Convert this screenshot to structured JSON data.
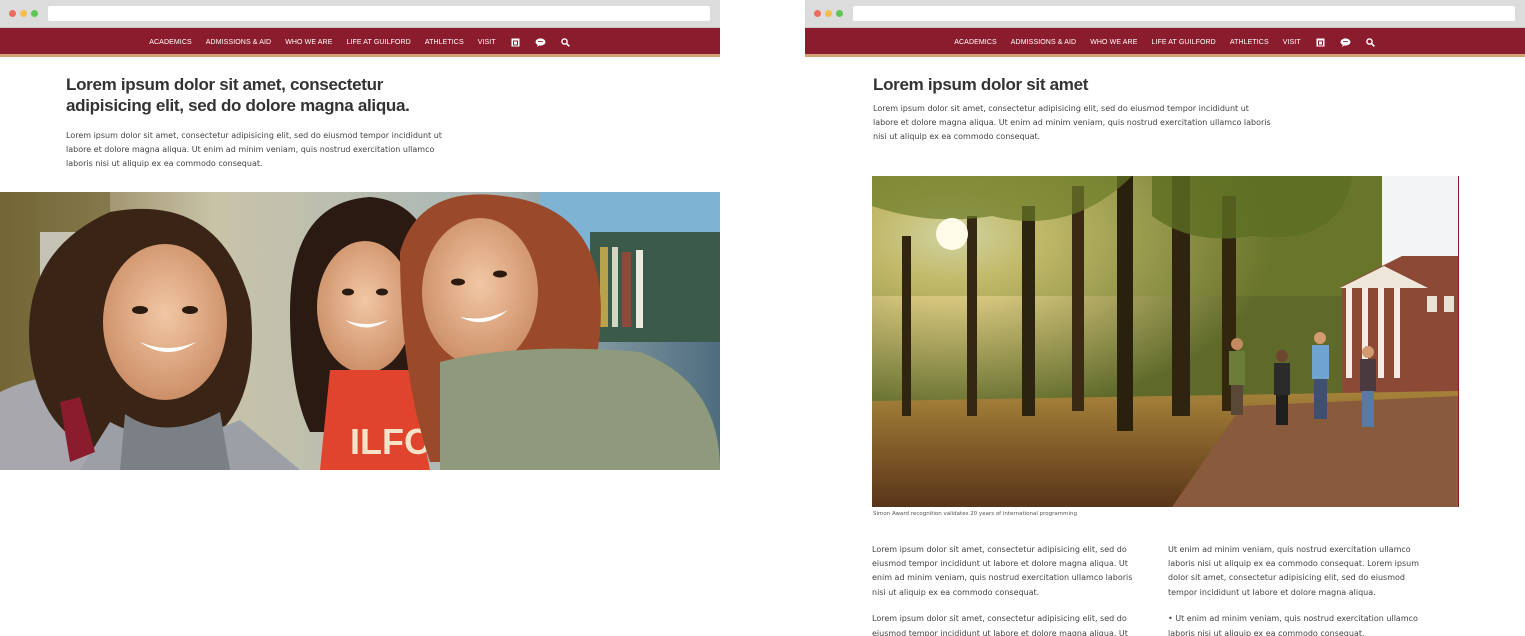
{
  "nav": {
    "items": [
      "Academics",
      "Admissions & Aid",
      "Who We Are",
      "Life at Guilford",
      "Athletics",
      "Visit"
    ],
    "icons": [
      "calendar-icon",
      "chat-icon",
      "search-icon"
    ]
  },
  "window1": {
    "headline": "Lorem ipsum dolor sit amet, consectetur adipisicing elit, sed do dolore magna aliqua.",
    "body": "Lorem ipsum dolor sit amet, consectetur adipisicing elit, sed do eiusmod tempor incididunt ut labore et dolore magna aliqua. Ut enim ad minim veniam, quis nostrud exercitation ullamco laboris nisi ut aliquip ex ea commodo consequat.",
    "hero_shirt_text": "ILFORD"
  },
  "window2": {
    "headline": "Lorem ipsum dolor sit amet",
    "body": "Lorem ipsum dolor sit amet, consectetur adipisicing elit, sed do eiusmod tempor incididunt ut labore et dolore magna aliqua. Ut enim ad minim veniam, quis nostrud exercitation ullamco laboris nisi ut aliquip ex ea commodo consequat.",
    "caption": "Simon Award recognition validates 20 years of international programming",
    "col_left": [
      "Lorem ipsum dolor sit amet, consectetur adipisicing elit, sed do eiusmod tempor incididunt ut labore et dolore magna aliqua. Ut enim ad minim veniam, quis nostrud exercitation ullamco laboris nisi ut aliquip ex ea commodo consequat.",
      "Lorem ipsum dolor sit amet, consectetur adipisicing elit, sed do eiusmod tempor incididunt ut labore et dolore magna aliqua. Ut"
    ],
    "col_right": [
      "Ut enim ad minim veniam, quis nostrud exercitation ullamco laboris nisi ut aliquip ex ea commodo consequat. Lorem ipsum dolor sit amet, consectetur adipisicing elit, sed do eiusmod tempor incididunt ut labore et dolore magna aliqua.",
      "• Ut enim ad minim veniam, quis nostrud exercitation ullamco laboris nisi ut aliquip ex ea commodo consequat."
    ]
  },
  "colors": {
    "nav_bg": "#8b1c2e",
    "nav_accent": "#d4a276",
    "text": "#333333"
  }
}
